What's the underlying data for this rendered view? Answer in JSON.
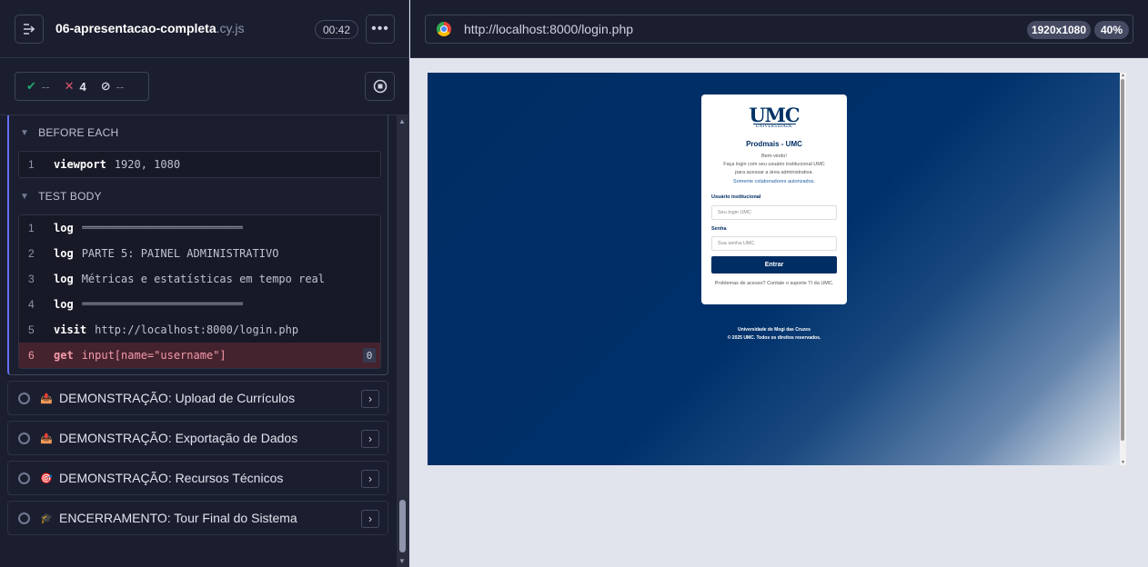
{
  "reporter": {
    "spec_name": "06-apresentacao-completa",
    "spec_ext": ".cy.js",
    "duration": "00:42",
    "stats": {
      "passed": "--",
      "failed": "4",
      "pending": "--"
    },
    "hooks": [
      {
        "title": "BEFORE EACH",
        "commands": [
          {
            "num": "1",
            "name": "viewport",
            "message": "1920, 1080"
          }
        ]
      },
      {
        "title": "TEST BODY",
        "commands": [
          {
            "num": "1",
            "name": "log",
            "message": "========================================"
          },
          {
            "num": "2",
            "name": "log",
            "message": "PARTE 5: PAINEL ADMINISTRATIVO"
          },
          {
            "num": "3",
            "name": "log",
            "message": "Métricas e estatísticas em tempo real"
          },
          {
            "num": "4",
            "name": "log",
            "message": "========================================"
          },
          {
            "num": "5",
            "name": "visit",
            "message": "http://localhost:8000/login.php"
          },
          {
            "num": "6",
            "name": "get",
            "message": "input[name=\"username\"]",
            "count": "0"
          }
        ]
      }
    ],
    "tests": [
      {
        "emoji": "📤",
        "title": "DEMONSTRAÇÃO: Upload de Currículos"
      },
      {
        "emoji": "📤",
        "title": "DEMONSTRAÇÃO: Exportação de Dados"
      },
      {
        "emoji": "🎯",
        "title": "DEMONSTRAÇÃO: Recursos Técnicos"
      },
      {
        "emoji": "🎓",
        "title": "ENCERRAMENTO: Tour Final do Sistema"
      }
    ]
  },
  "aut": {
    "url": "http://localhost:8000/login.php",
    "viewport": "1920x1080",
    "scale": "40%"
  },
  "login_page": {
    "logo": "UMC",
    "logo_sub": "UNIVERSIDADE",
    "title": "Prodmais - UMC",
    "welcome": "Bem-vindo!",
    "intro_line1": "Faça login com seu usuário institucional UMC",
    "intro_line2": "para acessar a área administrativa.",
    "intro_link": "Somente colaboradores autorizados.",
    "username_label": "Usuário institucional",
    "username_placeholder": "Seu login UMC",
    "password_label": "Senha",
    "password_placeholder": "Sua senha UMC",
    "submit_label": "Entrar",
    "help_text": "Problemas de acesso? Contate o suporte TI da UMC.",
    "footer_line1": "Universidade de Mogi das Cruzes",
    "footer_line2": "© 2025 UMC. Todos os direitos reservados."
  },
  "colors": {
    "brand_navy": "#002d63",
    "failed": "#e45770",
    "passed": "#1fa971",
    "active_border": "#6470f3"
  }
}
